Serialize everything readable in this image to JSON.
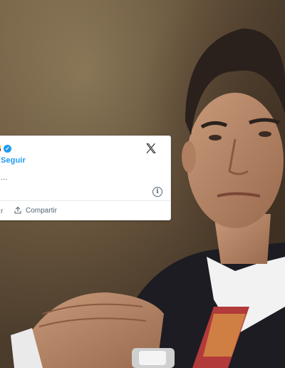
{
  "tweet": {
    "follow_label": "Seguir",
    "truncated_text": "...",
    "left_action_fragment": "r",
    "share_label": "Compartir"
  },
  "icons": {
    "platform_logo": "x-logo-icon",
    "verified": "verified-badge-icon",
    "info": "info-icon",
    "share": "share-upload-icon"
  },
  "colors": {
    "link_blue": "#1d9bf0",
    "muted_text": "#536471",
    "card_bg": "#ffffff"
  }
}
